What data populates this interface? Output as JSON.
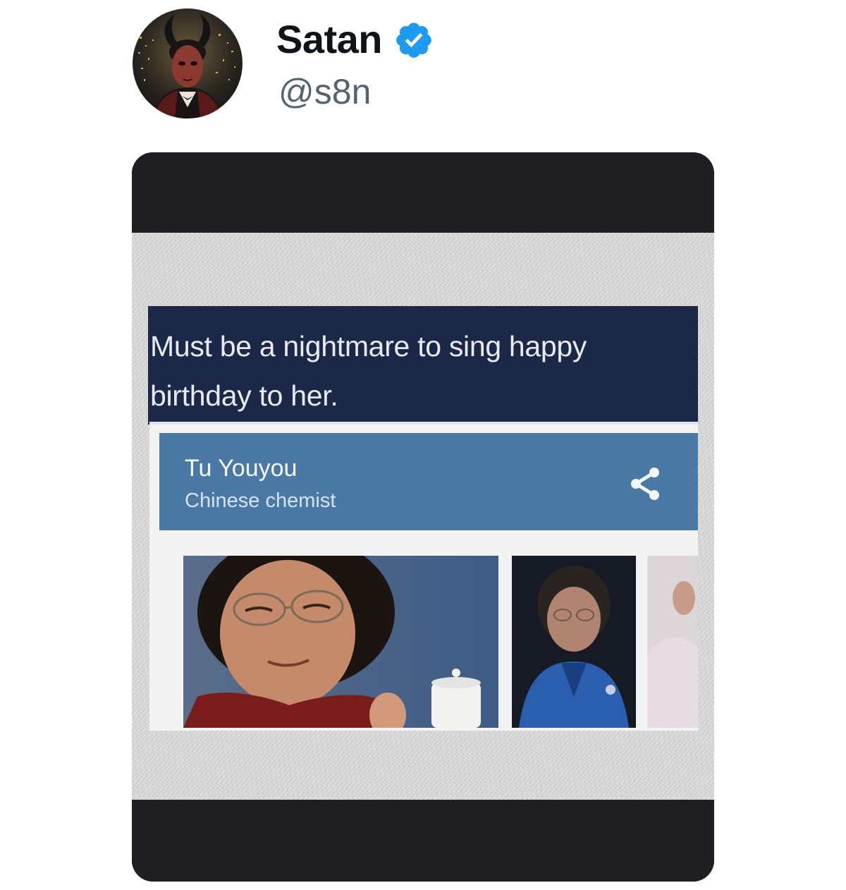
{
  "post": {
    "author": {
      "display_name": "Satan",
      "handle": "@s8n",
      "verified": true,
      "verified_color": "#1d9bf0"
    },
    "media": {
      "inner_post_text": "Must be a nightmare to sing happy birthday to her.",
      "knowledge_card": {
        "name": "Tu Youyou",
        "description": "Chinese chemist",
        "header_color": "#4b79a6",
        "share_icon": "share-icon"
      }
    }
  }
}
